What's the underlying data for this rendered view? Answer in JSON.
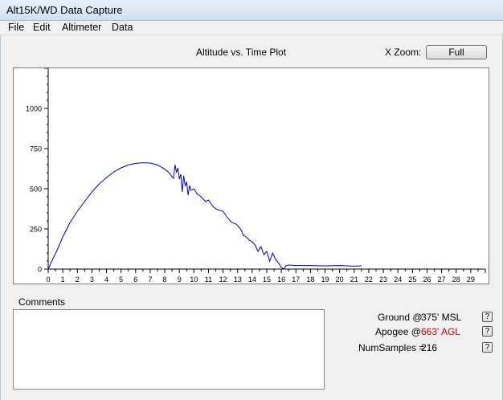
{
  "window": {
    "title": "Alt15K/WD Data Capture"
  },
  "menu": [
    "File",
    "Edit",
    "Altimeter",
    "Data"
  ],
  "plot": {
    "title": "Altitude vs. Time Plot",
    "xzoom_label": "X Zoom:",
    "xzoom_value": "Full"
  },
  "chart_data": {
    "type": "line",
    "title": "Altitude vs. Time Plot",
    "xlabel": "",
    "ylabel": "",
    "xlim": [
      0,
      30
    ],
    "ylim": [
      0,
      1250
    ],
    "x_ticks": [
      "0",
      "1",
      "2",
      "3",
      "4",
      "5",
      "6",
      "7",
      "8",
      "9",
      "10",
      "11",
      "12",
      "13",
      "14",
      "15",
      "16",
      "17",
      "18",
      "19",
      "20",
      "21",
      "22",
      "23",
      "24",
      "25",
      "26",
      "27",
      "28",
      "29"
    ],
    "y_ticks": [
      "0",
      "250",
      "500",
      "750",
      "1000"
    ],
    "series": [
      {
        "color": "#0000cc",
        "x": [
          0,
          0.3,
          0.6,
          1,
          1.5,
          2,
          2.5,
          3,
          3.5,
          4,
          4.5,
          5,
          5.5,
          6,
          6.5,
          7,
          7.5,
          8,
          8.3,
          8.5,
          8.6,
          8.7,
          8.8,
          8.9,
          9.0,
          9.1,
          9.2,
          9.3,
          9.4,
          9.5,
          9.6,
          9.7,
          9.8,
          10.0,
          10.2,
          10.5,
          10.8,
          11.0,
          11.3,
          11.6,
          12.0,
          12.3,
          12.6,
          12.9,
          13.2,
          13.4,
          13.6,
          13.8,
          14.0,
          14.2,
          14.4,
          14.6,
          14.8,
          15.0,
          15.2,
          15.4,
          15.6,
          15.8,
          16.0,
          16.2,
          16.3,
          16.5,
          17,
          18,
          19,
          20,
          21,
          21.5
        ],
        "y": [
          0,
          60,
          115,
          200,
          290,
          360,
          420,
          480,
          530,
          570,
          605,
          630,
          648,
          658,
          662,
          660,
          648,
          622,
          600,
          575,
          565,
          650,
          600,
          630,
          560,
          590,
          480,
          580,
          520,
          540,
          460,
          520,
          490,
          500,
          470,
          450,
          420,
          430,
          390,
          370,
          360,
          320,
          290,
          280,
          250,
          210,
          200,
          180,
          170,
          150,
          110,
          140,
          90,
          110,
          50,
          100,
          60,
          40,
          10,
          0,
          20,
          25,
          22,
          22,
          20,
          22,
          18,
          20
        ]
      }
    ]
  },
  "comments": {
    "label": "Comments",
    "value": ""
  },
  "info": {
    "ground_label": "Ground @",
    "ground_value": "375' MSL",
    "apogee_label": "Apogee @",
    "apogee_value": "663' AGL",
    "apogee_color": "#cc0000",
    "numsamples_label": "NumSamples =",
    "numsamples_value": "216",
    "help_glyph": "?"
  }
}
